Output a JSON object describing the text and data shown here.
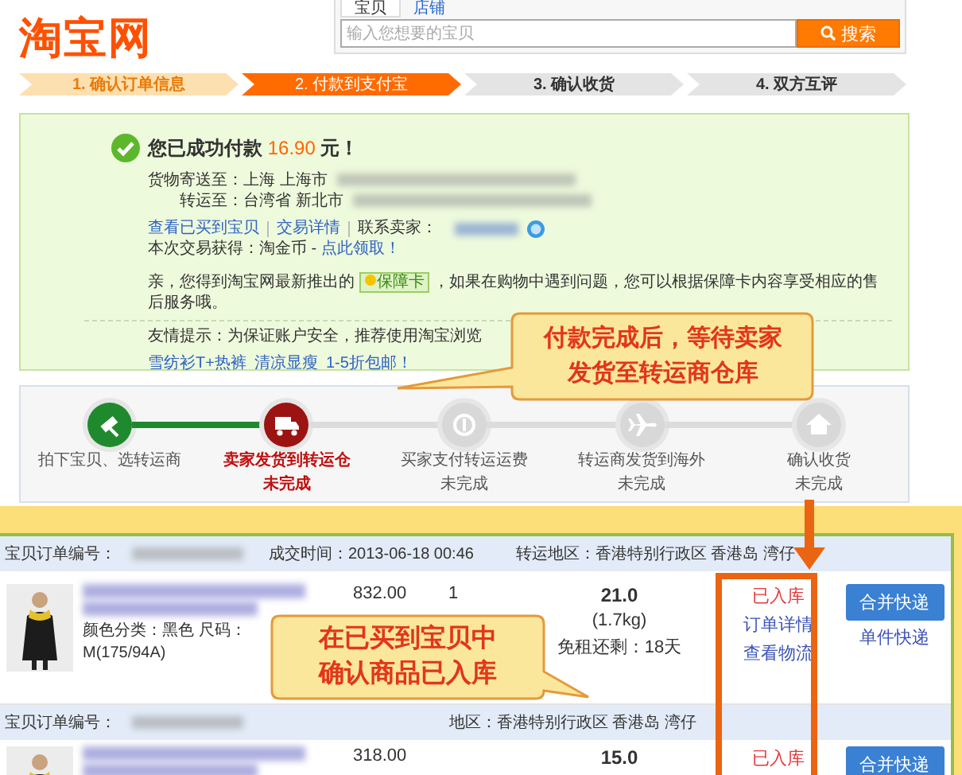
{
  "header": {
    "logo": "淘宝网",
    "search_tabs": [
      {
        "label": "宝贝",
        "selected": true
      },
      {
        "label": "店铺",
        "selected": false
      }
    ],
    "search": {
      "placeholder": "输入您想要的宝贝",
      "button": "搜索"
    }
  },
  "steps": [
    {
      "label": "1. 确认订单信息",
      "done": true,
      "selected": false
    },
    {
      "label": "2. 付款到支付宝",
      "done": false,
      "selected": true
    },
    {
      "label": "3. 确认收货",
      "done": false,
      "selected": false
    },
    {
      "label": "4. 双方互评",
      "done": false,
      "selected": false
    }
  ],
  "success": {
    "message": "您已成功付款",
    "amount": "16.90",
    "unit": "元！",
    "address": [
      {
        "label": "货物寄送至：",
        "value": "上海 上海市"
      },
      {
        "label": "转运至：",
        "value": "台湾省 新北市"
      }
    ],
    "links": [
      "查看已买到宝贝",
      "交易详情"
    ],
    "contact_label": "联系卖家：",
    "reward": {
      "text": "本次交易获得：淘金币 - ",
      "link": "点此领取！"
    },
    "notice": {
      "before": "亲，您得到淘宝网最新推出的",
      "badge": "保障卡",
      "after": "，如果在购物中遇到问题，您可以根据保障卡内容享受相应的售后服务哦。"
    },
    "tip": "友情提示：为保证账户安全，推荐使用淘宝浏览",
    "promo_links": [
      "雪纺衫T+热裤",
      "清凉显瘦",
      "1-5折包邮！"
    ]
  },
  "progress": [
    {
      "label": "拍下宝贝、选转运商",
      "kind": "gavel",
      "done": true,
      "current": false
    },
    {
      "label": "卖家发货到转运仓",
      "status": "未完成",
      "kind": "van",
      "done": false,
      "current": true
    },
    {
      "label": "买家支付转运运费",
      "status": "未完成",
      "kind": "coin",
      "done": false,
      "current": false
    },
    {
      "label": "转运商发货到海外",
      "status": "未完成",
      "kind": "plane",
      "done": false,
      "current": false
    },
    {
      "label": "确认收货",
      "status": "未完成",
      "kind": "house",
      "done": false,
      "current": false
    }
  ],
  "orders": [
    {
      "number_label": "宝贝订单编号：",
      "time": "成交时间：2013-06-18 00:46",
      "region": "转运地区：香港特别行政区 香港岛 湾仔",
      "item": {
        "attrs": [
          "颜色分类：黑色 尺码：",
          "M(175/94A)"
        ],
        "price": "832.00",
        "qty": "1",
        "weight": "21.0",
        "weight_kg": "(1.7kg)",
        "storage": "免租还剩：18天",
        "status": "已入库",
        "links": [
          "订单详情",
          "查看物流"
        ],
        "button": "合并快递",
        "link": "单件快递"
      }
    },
    {
      "number_label": "宝贝订单编号：",
      "region": "地区：香港特别行政区 香港岛 湾仔",
      "item": {
        "price": "318.00",
        "weight": "15.0",
        "status": "已入库",
        "button": "合并快递"
      }
    }
  ],
  "callouts": [
    {
      "lines": [
        "付款完成后，等待卖家",
        "发货至转运商仓库"
      ]
    },
    {
      "lines": [
        "在已买到宝贝中",
        "确认商品已入库"
      ]
    }
  ]
}
